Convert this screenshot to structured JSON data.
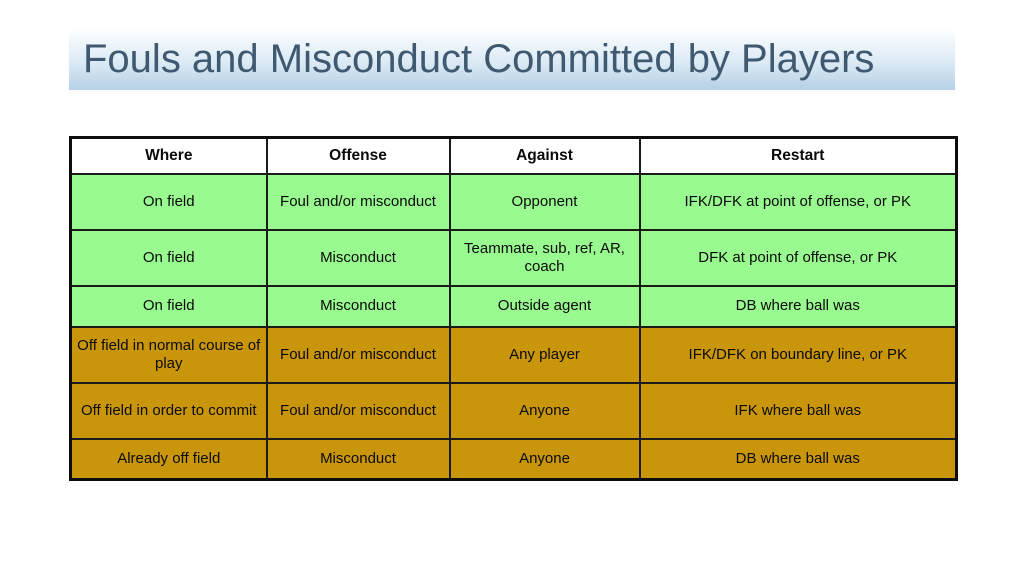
{
  "slide": {
    "title": "Fouls and Misconduct Committed by Players"
  },
  "colors": {
    "title_text": "#3f5970",
    "title_gradient_top": "#ffffff",
    "title_gradient_bottom": "#b6d1e6",
    "row_green": "#99fb8f",
    "row_gold": "#c9960b",
    "header_background": "#ffffff",
    "border": "#1a1a1a",
    "text": "#0a0a0a"
  },
  "table": {
    "columns": [
      "Where",
      "Offense",
      "Against",
      "Restart"
    ],
    "rows": [
      {
        "fill": "green",
        "height": "tall",
        "cells": [
          "On field",
          "Foul and/or misconduct",
          "Opponent",
          "IFK/DFK at point of offense, or PK"
        ]
      },
      {
        "fill": "green",
        "height": "tall",
        "cells": [
          "On field",
          "Misconduct",
          "Teammate, sub, ref, AR, coach",
          "DFK at point of offense, or PK"
        ]
      },
      {
        "fill": "green",
        "height": "short",
        "cells": [
          "On field",
          "Misconduct",
          "Outside agent",
          "DB where ball was"
        ]
      },
      {
        "fill": "gold",
        "height": "tall",
        "cells": [
          "Off field  in normal course of play",
          "Foul and/or misconduct",
          "Any player",
          "IFK/DFK on boundary line, or PK"
        ]
      },
      {
        "fill": "gold",
        "height": "tall",
        "cells": [
          "Off field in order to commit",
          "Foul and/or misconduct",
          "Anyone",
          "IFK where ball was"
        ]
      },
      {
        "fill": "gold",
        "height": "short",
        "cells": [
          "Already off field",
          "Misconduct",
          "Anyone",
          "DB where ball was"
        ]
      }
    ]
  }
}
